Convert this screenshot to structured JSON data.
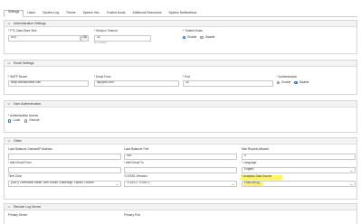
{
  "tabs": [
    {
      "label": "Settings"
    },
    {
      "label": "Users"
    },
    {
      "label": "System Log"
    },
    {
      "label": "Theme"
    },
    {
      "label": "System Info"
    },
    {
      "label": "Trusted Hosts"
    },
    {
      "label": "Additional Resources"
    },
    {
      "label": "System Notifications"
    }
  ],
  "admin": {
    "title": "Administration Settings",
    "ftc_label": "* FTC Data Store Size",
    "ftc_value": "50.0",
    "ftc_unit": "GB",
    "session_label": "* Session Timeout",
    "session_value": "30",
    "session_helper": "(in minutes)",
    "trusted_label": "* Trusted Hosts",
    "enable_label": "Enable",
    "disable_label": "Disable"
  },
  "email": {
    "title": "Email Settings",
    "smtp_label": "* SMTP Server",
    "smtp_value": "smtp.domainname.com",
    "from_label": "* Email From",
    "from_value": "ftpc@ftc.com",
    "port_label": "* Port",
    "port_value": "25",
    "auth_label": "* Authentication",
    "enable_label": "Enable",
    "disable_label": "Disable"
  },
  "userauth": {
    "title": "User Authentication",
    "access_label": "* Authentication Access",
    "local_label": "Local",
    "remote_label": "Remote"
  },
  "other": {
    "title": "Other",
    "lb_domain_label": "Load Balancer Domain/IP Address",
    "lb_port_label": "Load Balancer Port",
    "lb_port_value": "443",
    "max_reports_label": "Max Reports Allowed",
    "max_reports_value": "5",
    "email_from_label": "* Alert Email From",
    "email_to_label": "* Alert Email To",
    "language_label": "* Language",
    "language_value": "English",
    "timezone_label": "Time Zone",
    "timezone_value": "(GMT) Greenwich Mean Time Dublin, Edinburgh, Lisbon, London",
    "tls_label": "TLS/SSL Versions",
    "tls_value": "TLSv1.2, TLSv1.1",
    "analytics_label": "* Analytics Data Source",
    "analytics_value": "PostGreSQL"
  },
  "remote_log": {
    "title": "Remote Log Server",
    "primary_label": "Primary Server",
    "port_label": "Primary Port"
  }
}
